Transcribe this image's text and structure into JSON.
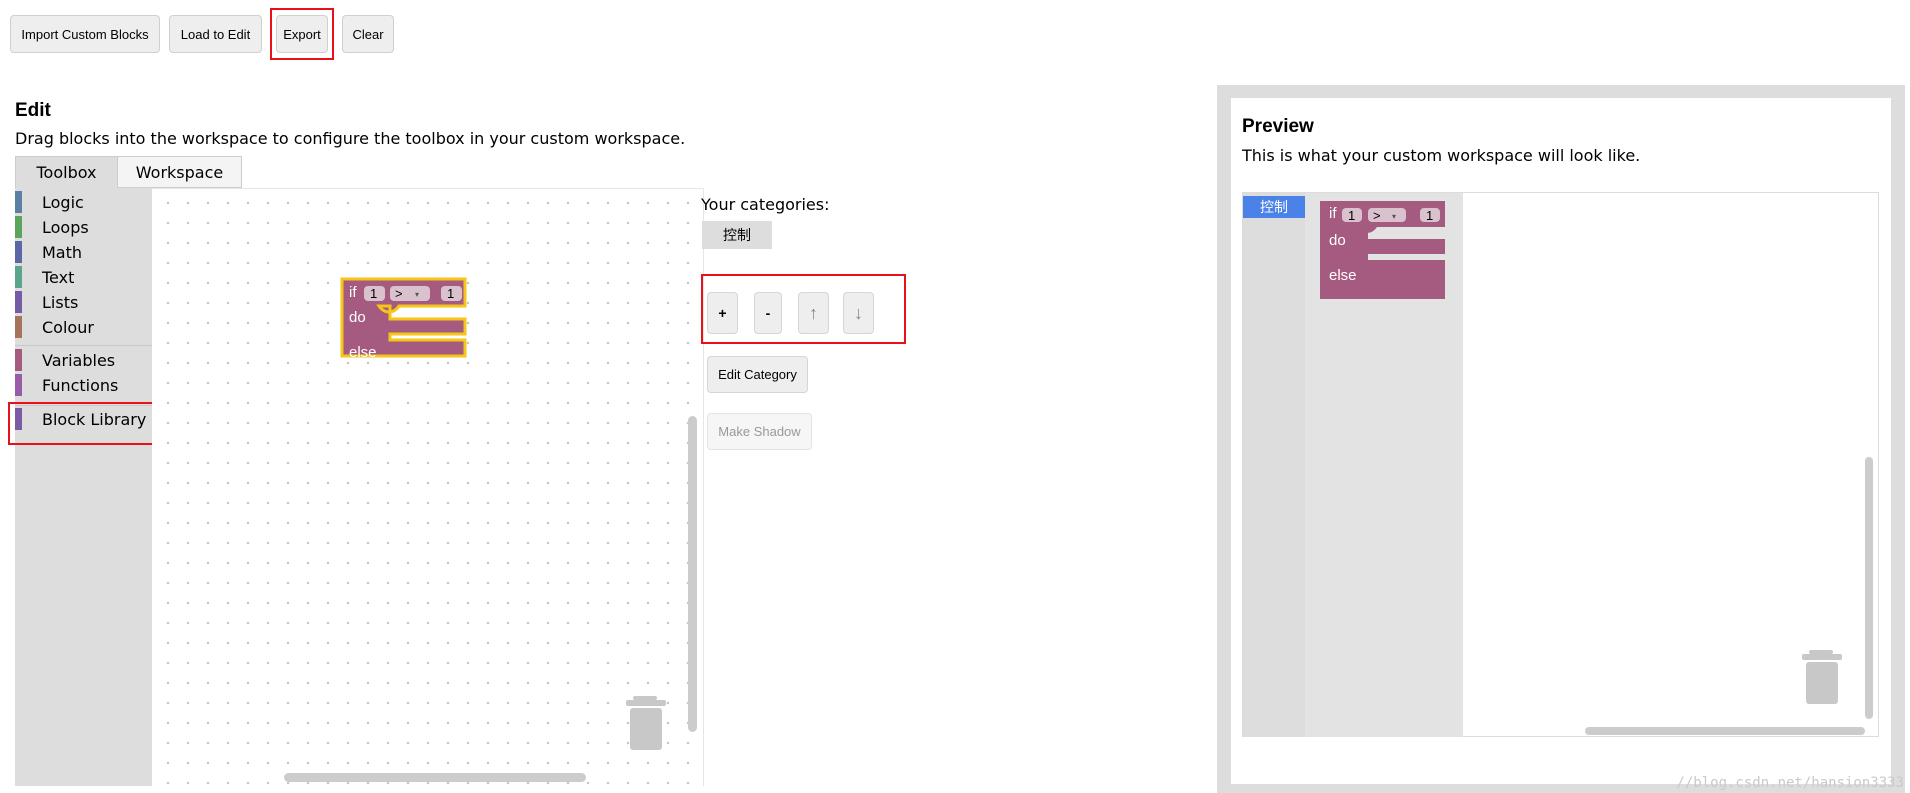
{
  "toolbar": {
    "import_label": "Import Custom Blocks",
    "load_label": "Load to Edit",
    "export_label": "Export",
    "clear_label": "Clear"
  },
  "edit": {
    "title": "Edit",
    "description": "Drag blocks into the workspace to configure the toolbox in your custom workspace.",
    "tabs": [
      {
        "label": "Toolbox",
        "active": true
      },
      {
        "label": "Workspace",
        "active": false
      }
    ],
    "categories": [
      {
        "label": "Logic",
        "color": "#5b80a5"
      },
      {
        "label": "Loops",
        "color": "#5ba55b"
      },
      {
        "label": "Math",
        "color": "#5b67a5"
      },
      {
        "label": "Text",
        "color": "#5ba58c"
      },
      {
        "label": "Lists",
        "color": "#745ba5"
      },
      {
        "label": "Colour",
        "color": "#a5745b"
      },
      {
        "label": "Variables",
        "color": "#a55b80"
      },
      {
        "label": "Functions",
        "color": "#995ba5"
      },
      {
        "label": "Block Library",
        "color": "#7b5ba5"
      }
    ]
  },
  "block": {
    "if_label": "if",
    "do_label": "do",
    "else_label": "else",
    "left_value": "1",
    "operator": ">",
    "right_value": "1",
    "color": "#a55b80"
  },
  "categories_panel": {
    "title": "Your categories:",
    "selected": "控制",
    "add_label": "+",
    "remove_label": "-",
    "up_label": "↑",
    "down_label": "↓",
    "edit_label": "Edit Category",
    "shadow_label": "Make Shadow"
  },
  "preview": {
    "title": "Preview",
    "description": "This is what your custom workspace will look like.",
    "category": "控制",
    "category_color": "#4a82e8"
  },
  "watermark": "//blog.csdn.net/hansion3333",
  "colors": {
    "highlight": "#e8111a",
    "block_outline": "#f5c518"
  }
}
